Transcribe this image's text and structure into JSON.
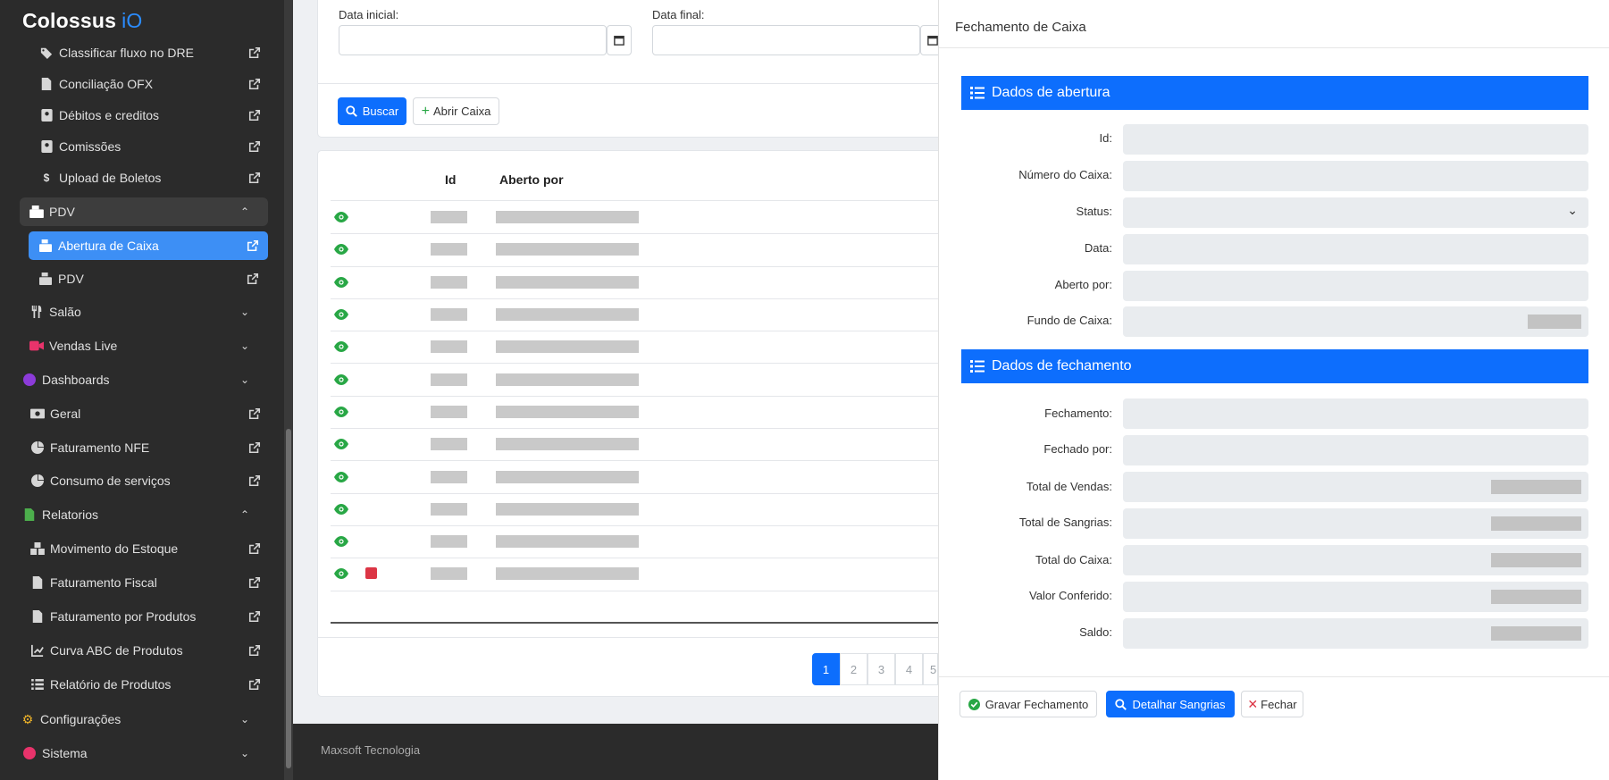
{
  "brand": {
    "name": "Colossus",
    "suffix": "iO"
  },
  "sidebar": {
    "items": [
      {
        "label": "Classificar fluxo no DRE",
        "icon": "tags-icon"
      },
      {
        "label": "Conciliação OFX",
        "icon": "file-icon"
      },
      {
        "label": "Débitos e creditos",
        "icon": "contact-card-icon"
      },
      {
        "label": "Comissões",
        "icon": "contact-card-icon"
      },
      {
        "label": "Upload de Boletos",
        "icon": "dollar-icon"
      },
      {
        "label": "PDV",
        "icon": "cash-register-icon"
      },
      {
        "label": "Abertura de Caixa",
        "icon": "cash-register-icon"
      },
      {
        "label": "PDV",
        "icon": "cash-register-icon"
      },
      {
        "label": "Salão",
        "icon": "utensils-icon"
      },
      {
        "label": "Vendas Live",
        "icon": "video-icon"
      },
      {
        "label": "Dashboards",
        "icon": "circle-icon"
      },
      {
        "label": "Geral",
        "icon": "money-icon"
      },
      {
        "label": "Faturamento NFE",
        "icon": "pie-chart-icon"
      },
      {
        "label": "Consumo de serviços",
        "icon": "pie-chart-icon"
      },
      {
        "label": "Relatorios",
        "icon": "file-icon"
      },
      {
        "label": "Movimento do Estoque",
        "icon": "boxes-icon"
      },
      {
        "label": "Faturamento Fiscal",
        "icon": "file-icon"
      },
      {
        "label": "Faturamento por Produtos",
        "icon": "file-icon"
      },
      {
        "label": "Curva ABC de Produtos",
        "icon": "chart-line-icon"
      },
      {
        "label": "Relatório de Produtos",
        "icon": "list-icon"
      },
      {
        "label": "Configurações",
        "icon": "cogs-icon"
      },
      {
        "label": "Sistema",
        "icon": "circle-icon"
      }
    ]
  },
  "filters": {
    "start_label": "Data inicial:",
    "end_label": "Data final:",
    "search_button": "Buscar",
    "open_button": "Abrir Caixa"
  },
  "table": {
    "headers": {
      "id": "Id",
      "opened_by": "Aberto por"
    },
    "row_count": 12
  },
  "pagination": {
    "pages": [
      "1",
      "2",
      "3",
      "4",
      "5"
    ],
    "current": "1"
  },
  "footer": {
    "text": "Maxsoft Tecnologia"
  },
  "panel": {
    "title": "Fechamento de Caixa",
    "opening_section": "Dados de abertura",
    "closing_section": "Dados de fechamento",
    "opening_fields": {
      "id": "Id:",
      "number": "Número do Caixa:",
      "status": "Status:",
      "date": "Data:",
      "opened_by": "Aberto por:",
      "fund": "Fundo de Caixa:"
    },
    "closing_fields": {
      "closing": "Fechamento:",
      "closed_by": "Fechado por:",
      "total_sales": "Total de Vendas:",
      "total_withdrawals": "Total de Sangrias:",
      "total_cash": "Total do Caixa:",
      "checked_value": "Valor Conferido:",
      "balance": "Saldo:"
    },
    "buttons": {
      "save": "Gravar Fechamento",
      "details": "Detalhar Sangrias",
      "close": "Fechar"
    }
  },
  "colors": {
    "primary": "#0d6efd",
    "sidebar_bg": "#2b2b2b",
    "active_item": "#3d8ff5",
    "eye_green": "#28a745"
  }
}
